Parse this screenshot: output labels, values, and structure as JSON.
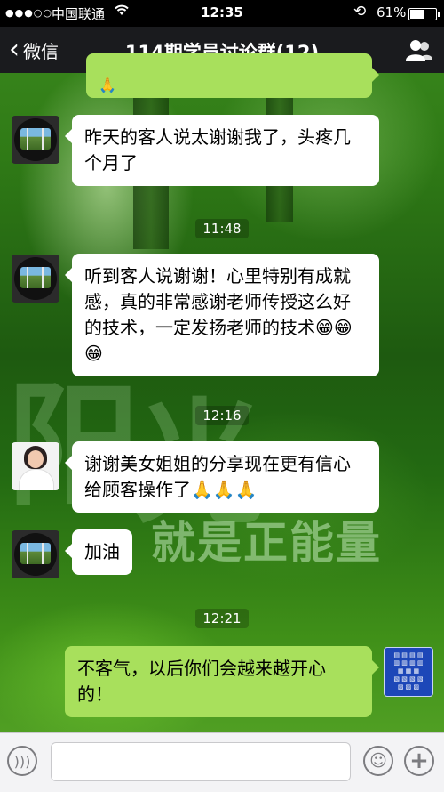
{
  "status_bar": {
    "signal_dots": "●●●○○",
    "carrier": "中国联通",
    "time": "12:35",
    "battery_percent": "61%",
    "battery_level": 0.61
  },
  "nav": {
    "back_label": "微信",
    "title": "114期学员讨论群(12)"
  },
  "messages": [
    {
      "type": "text",
      "side": "left",
      "avatar": "nature-avatar",
      "text": "昨天的客人说太谢谢我了，头疼几个月了"
    },
    {
      "type": "time",
      "text": "11:48"
    },
    {
      "type": "text",
      "side": "left",
      "avatar": "nature-avatar",
      "text": "听到客人说谢谢！心里特别有成就感，真的非常感谢老师传授这么好的技术，一定发扬老师的技术😁😁😁"
    },
    {
      "type": "time",
      "text": "12:16"
    },
    {
      "type": "text",
      "side": "left",
      "avatar": "woman-avatar",
      "text": "谢谢美女姐姐的分享现在更有信心给顾客操作了🙏🙏🙏"
    },
    {
      "type": "text",
      "side": "left",
      "avatar": "nature-avatar",
      "text": "加油"
    },
    {
      "type": "time",
      "text": "12:21"
    },
    {
      "type": "text",
      "side": "right",
      "avatar": "poster-avatar",
      "text": "不客气，以后你们会越来越开心的！"
    }
  ],
  "partial_top_bubble_emoji": "🙏",
  "background_slogan": "就是正能量",
  "input_bar": {
    "voice_icon": "voice-icon",
    "emoji_icon": "emoji-icon",
    "plus_icon": "plus-icon"
  },
  "colors": {
    "own_bubble": "#a8e05c",
    "other_bubble": "#ffffff",
    "nav_bg": "#1a1b1e"
  }
}
